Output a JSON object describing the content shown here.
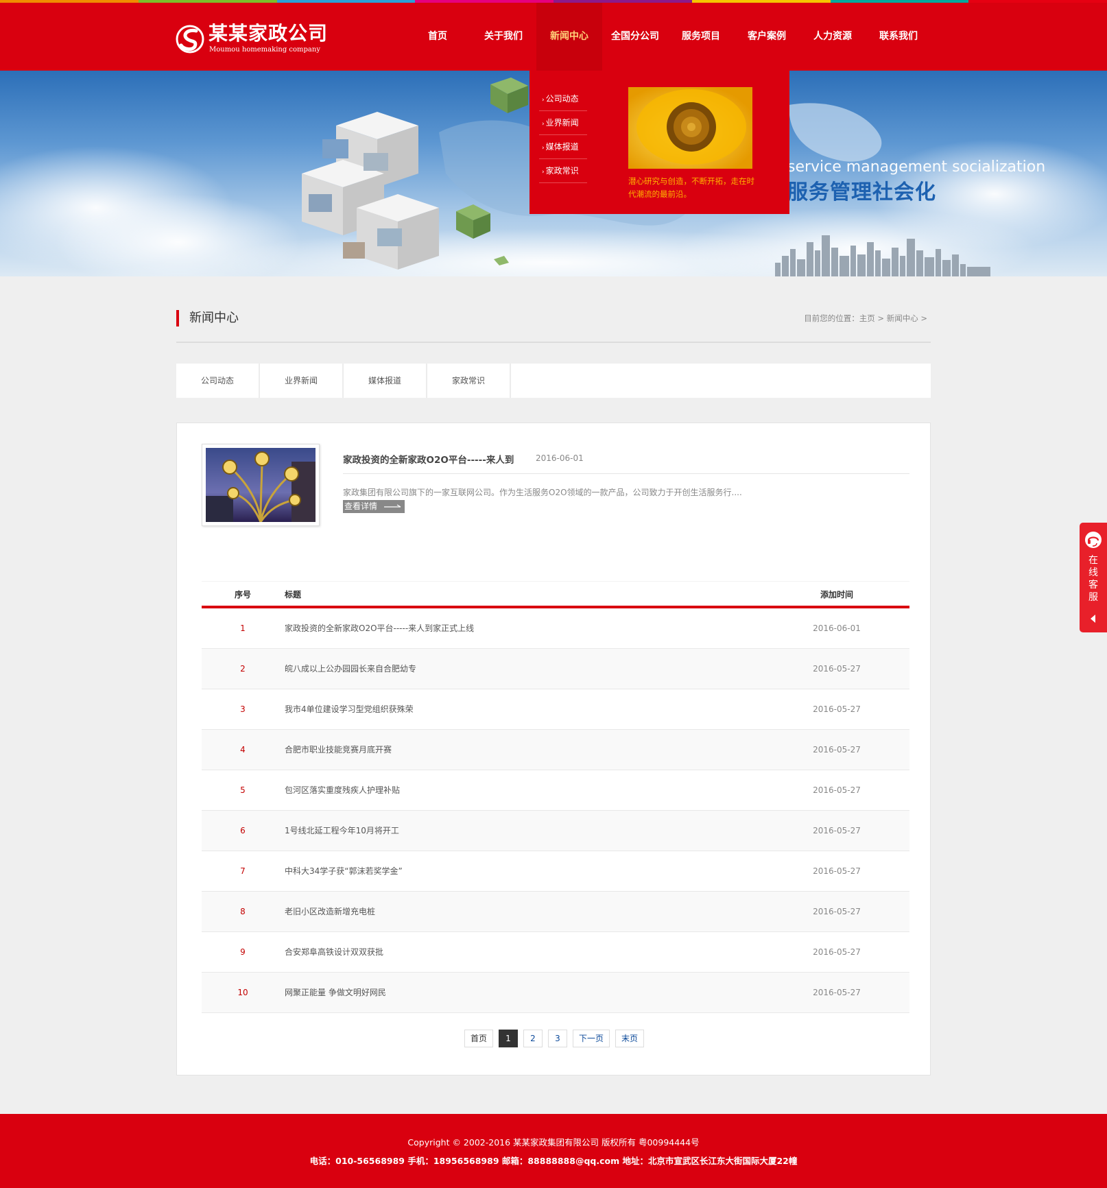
{
  "colors": {
    "brand_red": "#d9000f",
    "nav_active_text": "#ffd27a",
    "dropdown_text_yellow": "#ffb400",
    "strip": [
      "#f08c00",
      "#7bbf2a",
      "#2aa1d8",
      "#e6007e",
      "#8c1a8c",
      "#f5c400",
      "#00a99d",
      "#e60012"
    ]
  },
  "logo": {
    "name_cn": "某某家政公司",
    "name_en": "Moumou homemaking company",
    "icon": "logo-swirl-icon"
  },
  "nav": {
    "items": [
      "首页",
      "关于我们",
      "新闻中心",
      "全国分公司",
      "服务项目",
      "客户案例",
      "人力资源",
      "联系我们"
    ],
    "active_index": 2
  },
  "banner": {
    "slogan_en": "service management socialization",
    "slogan_cn": "服务管理社会化"
  },
  "dropdown": {
    "items": [
      "公司动态",
      "业界新闻",
      "媒体报道",
      "家政常识"
    ],
    "image_alt": "sunflower-image",
    "promo_text": "潜心研究与创造，不断开拓，走在时代潮流的最前沿。"
  },
  "page": {
    "title": "新闻中心",
    "breadcrumb_prefix": "目前您的位置：",
    "breadcrumb_home": "主页",
    "breadcrumb_current": "新闻中心",
    "breadcrumb_sep": ">"
  },
  "subtabs": [
    "公司动态",
    "业界新闻",
    "媒体报道",
    "家政常识"
  ],
  "featured": {
    "title": "家政投资的全新家政O2O平台-----来人到",
    "date": "2016-06-01",
    "summary": "家政集团有限公司旗下的一家互联网公司。作为生活服务O2O领域的一款产品，公司致力于开创生活服务行....",
    "more_label": "查看详情"
  },
  "table": {
    "headers": {
      "no": "序号",
      "title": "标题",
      "date": "添加时间"
    },
    "rows": [
      {
        "no": "1",
        "title": "家政投资的全新家政O2O平台-----来人到家正式上线",
        "date": "2016-06-01"
      },
      {
        "no": "2",
        "title": "皖八成以上公办园园长来自合肥幼专",
        "date": "2016-05-27"
      },
      {
        "no": "3",
        "title": "我市4单位建设学习型党组织获殊荣",
        "date": "2016-05-27"
      },
      {
        "no": "4",
        "title": "合肥市职业技能竞赛月底开赛",
        "date": "2016-05-27"
      },
      {
        "no": "5",
        "title": "包河区落实重度残疾人护理补贴",
        "date": "2016-05-27"
      },
      {
        "no": "6",
        "title": "1号线北延工程今年10月将开工",
        "date": "2016-05-27"
      },
      {
        "no": "7",
        "title": "中科大34学子获“郭沫若奖学金”",
        "date": "2016-05-27"
      },
      {
        "no": "8",
        "title": "老旧小区改造新增充电桩",
        "date": "2016-05-27"
      },
      {
        "no": "9",
        "title": "合安郑阜高铁设计双双获批",
        "date": "2016-05-27"
      },
      {
        "no": "10",
        "title": "网聚正能量 争做文明好网民",
        "date": "2016-05-27"
      }
    ]
  },
  "pager": {
    "first": "首页",
    "pages": [
      "1",
      "2",
      "3"
    ],
    "current": "1",
    "next": "下一页",
    "last": "末页"
  },
  "footer": {
    "copyright": "Copyright © 2002-2016 某某家政集团有限公司 版权所有 粤00994444号",
    "contact": "电话：010-56568989 手机：18956568989 邮箱：88888888@qq.com 地址：北京市宣武区长江东大街国际大厦22幢"
  },
  "service": {
    "label": "在线客服",
    "icon": "headset-icon"
  }
}
